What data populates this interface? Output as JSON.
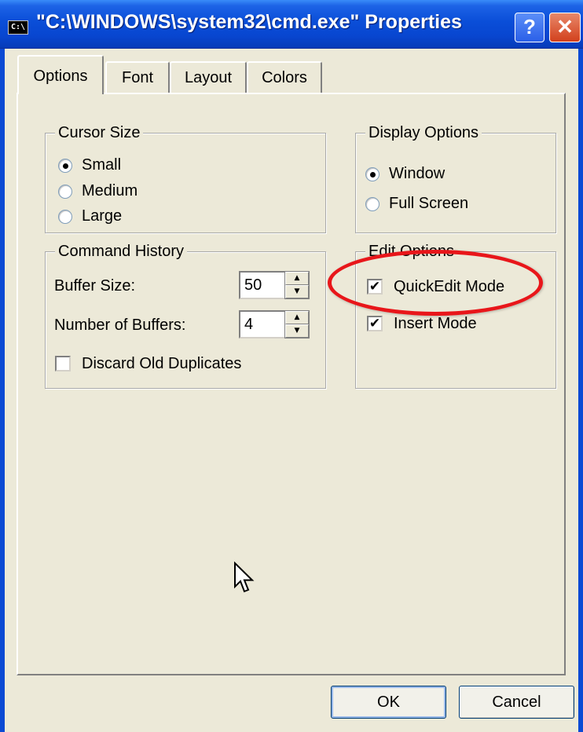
{
  "window": {
    "app_icon": "C:\\",
    "title": "\"C:\\WINDOWS\\system32\\cmd.exe\" Properties",
    "help_label": "?",
    "close_label": "✕"
  },
  "tabs": [
    {
      "label": "Options",
      "selected": true
    },
    {
      "label": "Font",
      "selected": false
    },
    {
      "label": "Layout",
      "selected": false
    },
    {
      "label": "Colors",
      "selected": false
    }
  ],
  "cursor_size": {
    "title": "Cursor Size",
    "options": [
      {
        "label": "Small",
        "checked": true
      },
      {
        "label": "Medium",
        "checked": false
      },
      {
        "label": "Large",
        "checked": false
      }
    ]
  },
  "display_options": {
    "title": "Display Options",
    "options": [
      {
        "label": "Window",
        "checked": true
      },
      {
        "label": "Full Screen",
        "checked": false
      }
    ]
  },
  "command_history": {
    "title": "Command History",
    "buffer_size_label": "Buffer Size:",
    "buffer_size_value": "50",
    "num_buffers_label": "Number of Buffers:",
    "num_buffers_value": "4",
    "discard_label": "Discard Old Duplicates",
    "discard_checked": false
  },
  "edit_options": {
    "title": "Edit Options",
    "quickedit_label": "QuickEdit Mode",
    "quickedit_checked": true,
    "insert_label": "Insert Mode",
    "insert_checked": true,
    "check_mark": "✔"
  },
  "buttons": {
    "ok": "OK",
    "cancel": "Cancel"
  },
  "spinner": {
    "up_arrow": "▲",
    "down_arrow": "▼"
  },
  "colors": {
    "title_bar": "#0a4ed8",
    "dialog_bg": "#ece9d8",
    "highlight": "#e8161a"
  }
}
